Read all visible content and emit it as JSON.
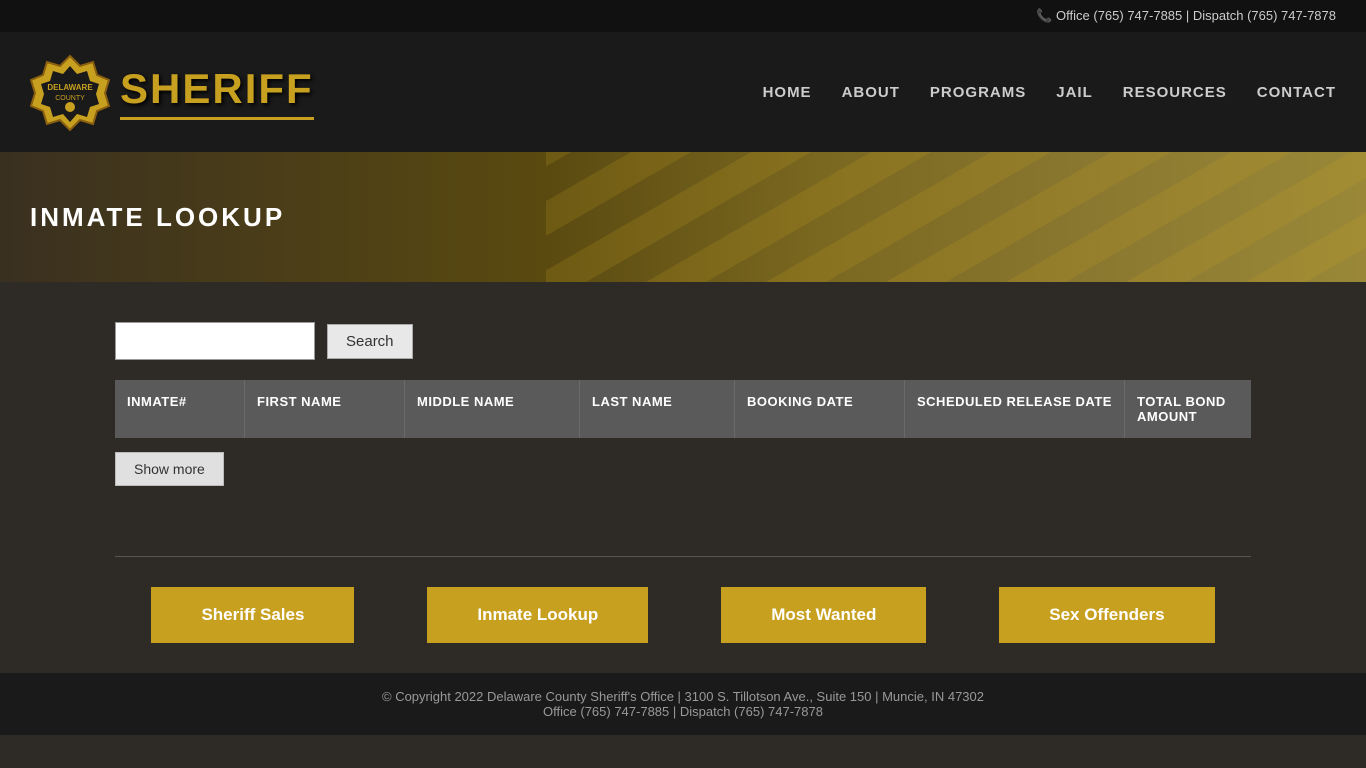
{
  "topbar": {
    "office_label": "Office",
    "office_phone": "(765) 747-7885",
    "separator": "|",
    "dispatch_label": "Dispatch",
    "dispatch_phone": "(765) 747-7878"
  },
  "header": {
    "badge_alt": "Sheriff Badge",
    "sheriff_name": "SHERIFF",
    "nav": [
      {
        "id": "home",
        "label": "HOME"
      },
      {
        "id": "about",
        "label": "ABOUT"
      },
      {
        "id": "programs",
        "label": "PROGRAMS"
      },
      {
        "id": "jail",
        "label": "JAIL"
      },
      {
        "id": "resources",
        "label": "RESOURCES"
      },
      {
        "id": "contact",
        "label": "CONTACT"
      }
    ]
  },
  "hero": {
    "title": "INMATE LOOKUP"
  },
  "search": {
    "placeholder": "",
    "button_label": "Search"
  },
  "table": {
    "columns": [
      {
        "id": "inmate",
        "label": "INMATE#"
      },
      {
        "id": "fname",
        "label": "FIRST NAME"
      },
      {
        "id": "mname",
        "label": "MIDDLE NAME"
      },
      {
        "id": "lname",
        "label": "LAST NAME"
      },
      {
        "id": "booking",
        "label": "BOOKING DATE"
      },
      {
        "id": "sched",
        "label": "SCHEDULED RELEASE DATE"
      },
      {
        "id": "bond",
        "label": "TOTAL BOND AMOUNT"
      }
    ]
  },
  "show_more": {
    "label": "Show more"
  },
  "footer_links": [
    {
      "id": "sheriff-sales",
      "label": "Sheriff Sales"
    },
    {
      "id": "inmate-lookup",
      "label": "Inmate Lookup"
    },
    {
      "id": "most-wanted",
      "label": "Most Wanted"
    },
    {
      "id": "sex-offenders",
      "label": "Sex Offenders"
    }
  ],
  "footer": {
    "copyright": "© Copyright 2022 Delaware County Sheriff's Office  |  3100 S. Tillotson Ave., Suite 150  |  Muncie, IN 47302",
    "contact": "Office (765) 747-7885  |  Dispatch (765) 747-7878"
  }
}
